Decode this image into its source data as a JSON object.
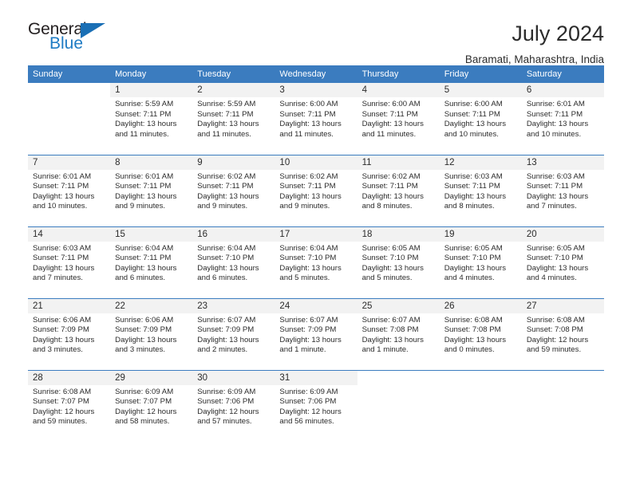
{
  "brand": {
    "name_part1": "General",
    "name_part2": "Blue",
    "logo_icon": "triangle-icon"
  },
  "header": {
    "title": "July 2024",
    "subtitle": "Baramati, Maharashtra, India"
  },
  "calendar": {
    "weekday_headers": [
      "Sunday",
      "Monday",
      "Tuesday",
      "Wednesday",
      "Thursday",
      "Friday",
      "Saturday"
    ],
    "header_color": "#3b7cbf",
    "daynum_band_color": "#f2f2f2",
    "weeks": [
      [
        {
          "empty": true
        },
        {
          "day": "1",
          "sunrise": "Sunrise: 5:59 AM",
          "sunset": "Sunset: 7:11 PM",
          "daylight": "Daylight: 13 hours and 11 minutes."
        },
        {
          "day": "2",
          "sunrise": "Sunrise: 5:59 AM",
          "sunset": "Sunset: 7:11 PM",
          "daylight": "Daylight: 13 hours and 11 minutes."
        },
        {
          "day": "3",
          "sunrise": "Sunrise: 6:00 AM",
          "sunset": "Sunset: 7:11 PM",
          "daylight": "Daylight: 13 hours and 11 minutes."
        },
        {
          "day": "4",
          "sunrise": "Sunrise: 6:00 AM",
          "sunset": "Sunset: 7:11 PM",
          "daylight": "Daylight: 13 hours and 11 minutes."
        },
        {
          "day": "5",
          "sunrise": "Sunrise: 6:00 AM",
          "sunset": "Sunset: 7:11 PM",
          "daylight": "Daylight: 13 hours and 10 minutes."
        },
        {
          "day": "6",
          "sunrise": "Sunrise: 6:01 AM",
          "sunset": "Sunset: 7:11 PM",
          "daylight": "Daylight: 13 hours and 10 minutes."
        }
      ],
      [
        {
          "day": "7",
          "sunrise": "Sunrise: 6:01 AM",
          "sunset": "Sunset: 7:11 PM",
          "daylight": "Daylight: 13 hours and 10 minutes."
        },
        {
          "day": "8",
          "sunrise": "Sunrise: 6:01 AM",
          "sunset": "Sunset: 7:11 PM",
          "daylight": "Daylight: 13 hours and 9 minutes."
        },
        {
          "day": "9",
          "sunrise": "Sunrise: 6:02 AM",
          "sunset": "Sunset: 7:11 PM",
          "daylight": "Daylight: 13 hours and 9 minutes."
        },
        {
          "day": "10",
          "sunrise": "Sunrise: 6:02 AM",
          "sunset": "Sunset: 7:11 PM",
          "daylight": "Daylight: 13 hours and 9 minutes."
        },
        {
          "day": "11",
          "sunrise": "Sunrise: 6:02 AM",
          "sunset": "Sunset: 7:11 PM",
          "daylight": "Daylight: 13 hours and 8 minutes."
        },
        {
          "day": "12",
          "sunrise": "Sunrise: 6:03 AM",
          "sunset": "Sunset: 7:11 PM",
          "daylight": "Daylight: 13 hours and 8 minutes."
        },
        {
          "day": "13",
          "sunrise": "Sunrise: 6:03 AM",
          "sunset": "Sunset: 7:11 PM",
          "daylight": "Daylight: 13 hours and 7 minutes."
        }
      ],
      [
        {
          "day": "14",
          "sunrise": "Sunrise: 6:03 AM",
          "sunset": "Sunset: 7:11 PM",
          "daylight": "Daylight: 13 hours and 7 minutes."
        },
        {
          "day": "15",
          "sunrise": "Sunrise: 6:04 AM",
          "sunset": "Sunset: 7:11 PM",
          "daylight": "Daylight: 13 hours and 6 minutes."
        },
        {
          "day": "16",
          "sunrise": "Sunrise: 6:04 AM",
          "sunset": "Sunset: 7:10 PM",
          "daylight": "Daylight: 13 hours and 6 minutes."
        },
        {
          "day": "17",
          "sunrise": "Sunrise: 6:04 AM",
          "sunset": "Sunset: 7:10 PM",
          "daylight": "Daylight: 13 hours and 5 minutes."
        },
        {
          "day": "18",
          "sunrise": "Sunrise: 6:05 AM",
          "sunset": "Sunset: 7:10 PM",
          "daylight": "Daylight: 13 hours and 5 minutes."
        },
        {
          "day": "19",
          "sunrise": "Sunrise: 6:05 AM",
          "sunset": "Sunset: 7:10 PM",
          "daylight": "Daylight: 13 hours and 4 minutes."
        },
        {
          "day": "20",
          "sunrise": "Sunrise: 6:05 AM",
          "sunset": "Sunset: 7:10 PM",
          "daylight": "Daylight: 13 hours and 4 minutes."
        }
      ],
      [
        {
          "day": "21",
          "sunrise": "Sunrise: 6:06 AM",
          "sunset": "Sunset: 7:09 PM",
          "daylight": "Daylight: 13 hours and 3 minutes."
        },
        {
          "day": "22",
          "sunrise": "Sunrise: 6:06 AM",
          "sunset": "Sunset: 7:09 PM",
          "daylight": "Daylight: 13 hours and 3 minutes."
        },
        {
          "day": "23",
          "sunrise": "Sunrise: 6:07 AM",
          "sunset": "Sunset: 7:09 PM",
          "daylight": "Daylight: 13 hours and 2 minutes."
        },
        {
          "day": "24",
          "sunrise": "Sunrise: 6:07 AM",
          "sunset": "Sunset: 7:09 PM",
          "daylight": "Daylight: 13 hours and 1 minute."
        },
        {
          "day": "25",
          "sunrise": "Sunrise: 6:07 AM",
          "sunset": "Sunset: 7:08 PM",
          "daylight": "Daylight: 13 hours and 1 minute."
        },
        {
          "day": "26",
          "sunrise": "Sunrise: 6:08 AM",
          "sunset": "Sunset: 7:08 PM",
          "daylight": "Daylight: 13 hours and 0 minutes."
        },
        {
          "day": "27",
          "sunrise": "Sunrise: 6:08 AM",
          "sunset": "Sunset: 7:08 PM",
          "daylight": "Daylight: 12 hours and 59 minutes."
        }
      ],
      [
        {
          "day": "28",
          "sunrise": "Sunrise: 6:08 AM",
          "sunset": "Sunset: 7:07 PM",
          "daylight": "Daylight: 12 hours and 59 minutes."
        },
        {
          "day": "29",
          "sunrise": "Sunrise: 6:09 AM",
          "sunset": "Sunset: 7:07 PM",
          "daylight": "Daylight: 12 hours and 58 minutes."
        },
        {
          "day": "30",
          "sunrise": "Sunrise: 6:09 AM",
          "sunset": "Sunset: 7:06 PM",
          "daylight": "Daylight: 12 hours and 57 minutes."
        },
        {
          "day": "31",
          "sunrise": "Sunrise: 6:09 AM",
          "sunset": "Sunset: 7:06 PM",
          "daylight": "Daylight: 12 hours and 56 minutes."
        },
        {
          "empty": true
        },
        {
          "empty": true
        },
        {
          "empty": true
        }
      ]
    ]
  }
}
